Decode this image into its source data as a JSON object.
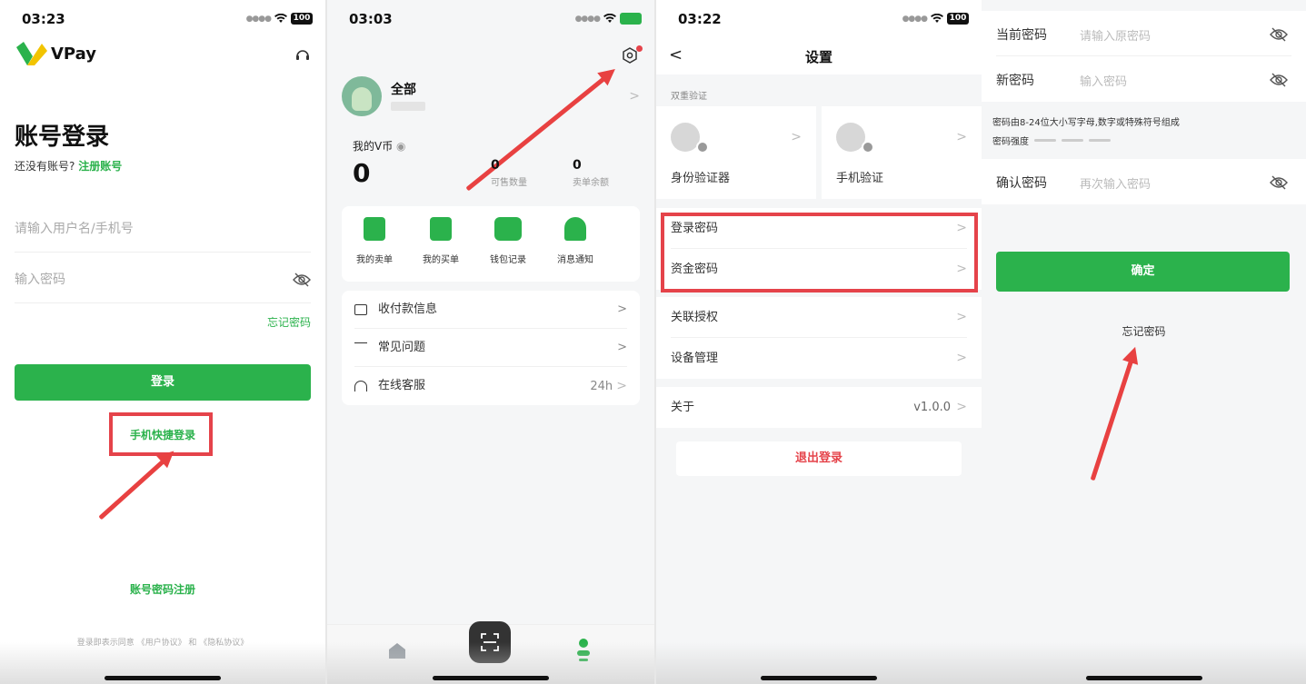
{
  "colors": {
    "brand_green": "#2bb24c",
    "highlight_red": "#e5434a",
    "page_bg": "#f5f6f7"
  },
  "login": {
    "status_time": "03:23",
    "battery": "100",
    "brand": "VPay",
    "title": "账号登录",
    "no_account": "还没有账号?",
    "register_link": "注册账号",
    "username_placeholder": "请输入用户名/手机号",
    "password_placeholder": "输入密码",
    "forgot": "忘记密码",
    "login_button": "登录",
    "quick_login": "手机快捷登录",
    "account_register": "账号密码注册",
    "terms": "登录即表示同意 《用户协议》 和 《隐私协议》",
    "icons": {
      "support": "headset-icon",
      "eye": "eye-off-icon"
    }
  },
  "profile": {
    "status_time": "03:03",
    "battery": "97",
    "name": "全部",
    "coin_label": "我的V币",
    "coin_value": "0",
    "sell_qty_value": "0",
    "sell_qty_label": "可售数量",
    "sell_balance_value": "0",
    "sell_balance_label": "卖单余额",
    "quick_actions": [
      {
        "label": "我的卖单",
        "icon": "sell-order-icon"
      },
      {
        "label": "我的买单",
        "icon": "buy-order-icon"
      },
      {
        "label": "钱包记录",
        "icon": "wallet-icon"
      },
      {
        "label": "消息通知",
        "icon": "bell-icon"
      }
    ],
    "menu": [
      {
        "label": "收付款信息",
        "icon": "card-icon",
        "right": ""
      },
      {
        "label": "常见问题",
        "icon": "question-icon",
        "right": ""
      },
      {
        "label": "在线客服",
        "icon": "headset-icon",
        "right": "24h"
      }
    ],
    "tabs": [
      "home-icon",
      "scan-icon",
      "profile-icon"
    ]
  },
  "settings": {
    "status_time": "03:22",
    "battery": "100",
    "title": "设置",
    "section": "双重验证",
    "auth": [
      {
        "label": "身份验证器",
        "icon": "authenticator-icon"
      },
      {
        "label": "手机验证",
        "icon": "phone-icon"
      }
    ],
    "password_rows": [
      "登录密码",
      "资金密码"
    ],
    "other_rows": [
      "关联授权",
      "设备管理"
    ],
    "about_label": "关于",
    "about_value": "v1.0.0",
    "logout": "退出登录"
  },
  "change_password": {
    "rows": [
      {
        "label": "当前密码",
        "placeholder": "请输入原密码"
      },
      {
        "label": "新密码",
        "placeholder": "输入密码"
      }
    ],
    "hint": "密码由8-24位大小写字母,数字或特殊符号组成",
    "strength_label": "密码强度",
    "confirm_label": "确认密码",
    "confirm_placeholder": "再次输入密码",
    "confirm_button": "确定",
    "forgot": "忘记密码"
  }
}
